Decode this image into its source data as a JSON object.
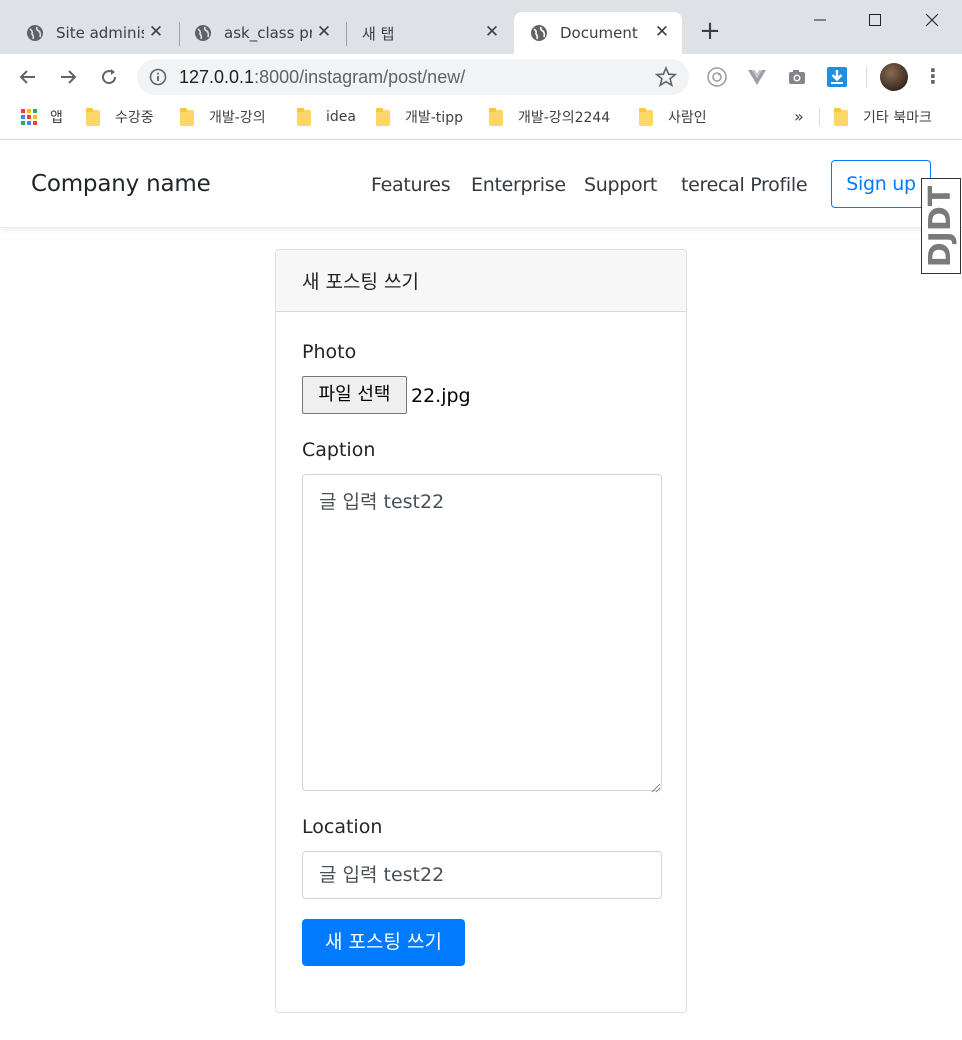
{
  "browser": {
    "tabs": [
      {
        "title": "Site administ",
        "active": false
      },
      {
        "title": "ask_class pro",
        "active": false
      },
      {
        "title": "새 탭",
        "active": false
      },
      {
        "title": "Document",
        "active": true
      }
    ],
    "close_glyph": "✕",
    "new_tab_glyph": "+",
    "address": {
      "host": "127.0.0.1",
      "path": ":8000/instagram/post/new/"
    },
    "bookmarks": {
      "apps_label": "앱",
      "folders": [
        "수강중",
        "개발-강의",
        "idea",
        "개발-tipp",
        "개발-강의2244",
        "사람인"
      ],
      "more": "»",
      "other": "기타 북마크"
    },
    "icons": {
      "tab": "globe-icon",
      "back": "back-arrow-icon",
      "forward": "forward-arrow-icon",
      "reload": "reload-icon",
      "info": "info-icon",
      "star": "star-icon",
      "folder": "folder-icon"
    }
  },
  "navbar": {
    "brand": "Company name",
    "links": [
      "Features",
      "Enterprise",
      "Support",
      "terecal Profile"
    ],
    "signup": "Sign up",
    "debug_toolbar": "DJDT"
  },
  "form": {
    "header": "새 포스팅 쓰기",
    "photo_label": "Photo",
    "file_button": "파일 선택",
    "file_name": "22.jpg",
    "caption_label": "Caption",
    "caption_value": "글 입력 test22",
    "location_label": "Location",
    "location_value": "글 입력 test22",
    "submit": "새 포스팅 쓰기"
  },
  "colors": {
    "primary": "#007bff",
    "tabstrip": "#dee1e6",
    "card_header": "#f7f7f7"
  }
}
